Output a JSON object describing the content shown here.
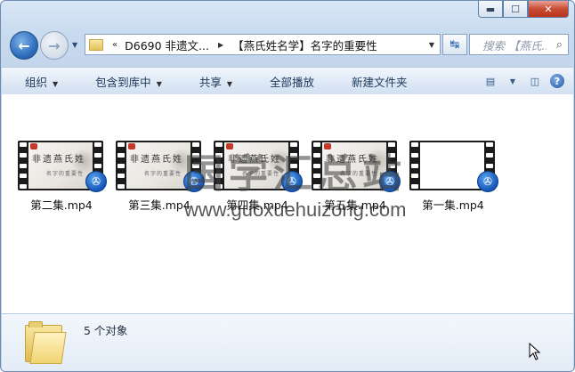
{
  "titlebar": {
    "minimize_icon": "minimize-icon",
    "maximize_icon": "maximize-icon",
    "close_icon": "close-icon"
  },
  "nav": {
    "address_parts": [
      "D6690 非遗文...",
      "【燕氏姓名学】名字的重要性"
    ],
    "chevrons": "«",
    "search_placeholder": "搜索 【燕氏..."
  },
  "toolbar": {
    "organize": "组织",
    "include_in_library": "包含到库中",
    "share": "共享",
    "play_all": "全部播放",
    "new_folder": "新建文件夹"
  },
  "files": [
    {
      "name": "第二集.mp4",
      "thumb_title": "非遗燕氏姓",
      "thumb_sub": "名字的重要性"
    },
    {
      "name": "第三集.mp4",
      "thumb_title": "非遗燕氏姓",
      "thumb_sub": "名字的重要性"
    },
    {
      "name": "第四集.mp4",
      "thumb_title": "非遗燕氏姓",
      "thumb_sub": "名字的重要性"
    },
    {
      "name": "第五集.mp4",
      "thumb_title": "非遗燕氏姓",
      "thumb_sub": "名字的重要性"
    },
    {
      "name": "第一集.mp4",
      "thumb_title": "",
      "thumb_sub": ""
    }
  ],
  "watermark": {
    "cn": "国学汇总站",
    "url": "www.guoxuehuizong.com"
  },
  "details": {
    "count_text": "5 个对象"
  },
  "colors": {
    "accent": "#2f6fbd",
    "close": "#c84b34"
  }
}
